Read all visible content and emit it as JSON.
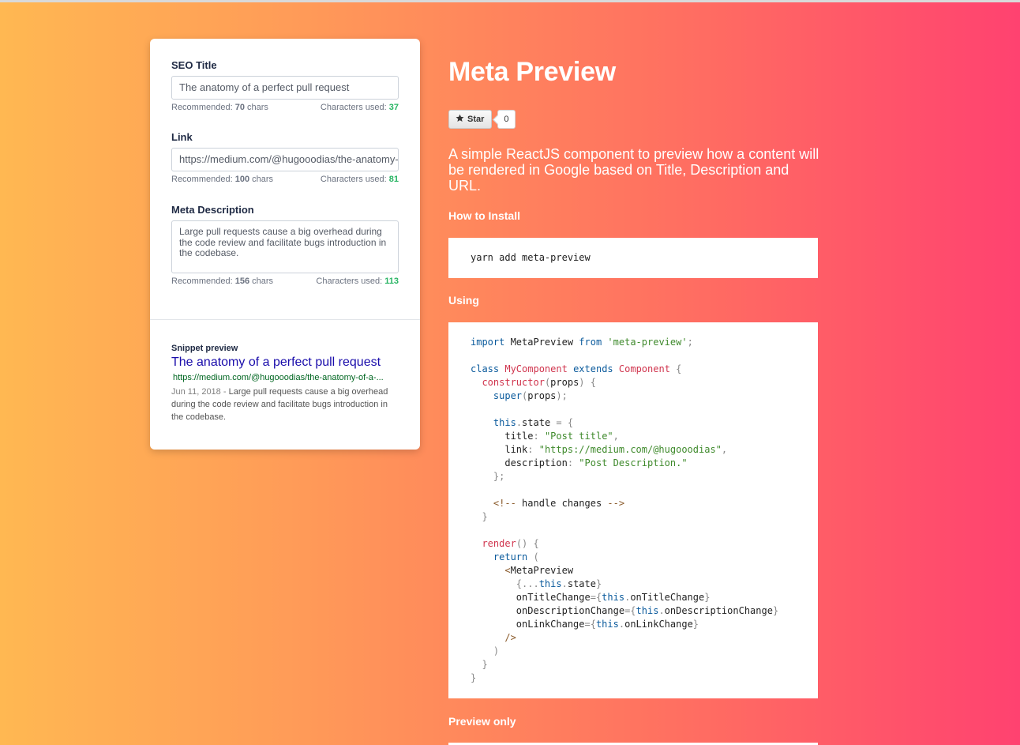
{
  "form": {
    "seo_title": {
      "label": "SEO Title",
      "value": "The anatomy of a perfect pull request",
      "recommended_prefix": "Recommended: ",
      "recommended_value": "70",
      "recommended_suffix": " chars",
      "used_prefix": "Characters used: ",
      "used_value": "37"
    },
    "link": {
      "label": "Link",
      "value": "https://medium.com/@hugooodias/the-anatomy-of-a-perfect-pull-request",
      "recommended_prefix": "Recommended: ",
      "recommended_value": "100",
      "recommended_suffix": " chars",
      "used_prefix": "Characters used: ",
      "used_value": "81"
    },
    "meta_description": {
      "label": "Meta Description",
      "value": "Large pull requests cause a big overhead during the code review and facilitate bugs introduction in the codebase.",
      "recommended_prefix": "Recommended: ",
      "recommended_value": "156",
      "recommended_suffix": " chars",
      "used_prefix": "Characters used: ",
      "used_value": "113"
    }
  },
  "snippet": {
    "label": "Snippet preview",
    "title": "The anatomy of a perfect pull request",
    "url": "https://medium.com/@hugooodias/the-anatomy-of-a-...",
    "date": "Jun 11, 2018 - ",
    "description": "Large pull requests cause a big overhead during the code review and facilitate bugs introduction in the codebase."
  },
  "page": {
    "heading": "Meta Preview",
    "star_label": "Star",
    "star_count": "0",
    "intro": "A simple ReactJS component to preview how a content will be rendered in Google based on Title, Description and URL.",
    "install_title": "How to Install",
    "install_code": "yarn add meta-preview",
    "using_title": "Using",
    "preview_only_title": "Preview only"
  },
  "code_lines": [
    "import MetaPreview from 'meta-preview';",
    "",
    "class MyComponent extends Component {",
    "  constructor(props) {",
    "    super(props);",
    "",
    "    this.state = {",
    "      title: \"Post title\",",
    "      link: \"https://medium.com/@hugooodias\",",
    "      description: \"Post Description.\"",
    "    };",
    "",
    "    <!-- handle changes -->",
    "  }",
    "",
    "  render() {",
    "    return (",
    "      <MetaPreview",
    "        {...this.state}",
    "        onTitleChange={this.onTitleChange}",
    "        onDescriptionChange={this.onDescriptionChange}",
    "        onLinkChange={this.onLinkChange}",
    "      />",
    "    )",
    "  }",
    "}"
  ],
  "colors": {
    "gradient_start": "#ffb852",
    "gradient_end": "#ff4270",
    "snippet_title": "#1a0dab",
    "snippet_url": "#006621",
    "used_count": "#28b463"
  }
}
